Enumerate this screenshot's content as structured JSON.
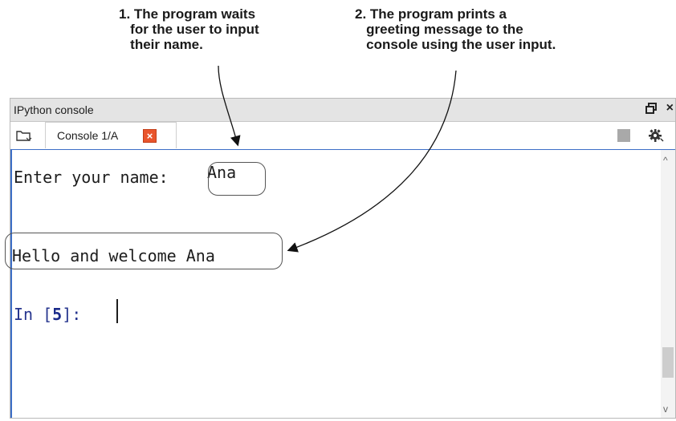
{
  "annotations": {
    "step1": "1. The program waits\n   for the user to input\n   their name.",
    "step2": "2. The program prints a\n   greeting message to the\n   console using the user input."
  },
  "window": {
    "title": "IPython console",
    "undock_icon": "undock-icon",
    "close_icon": "close-icon"
  },
  "tabs": {
    "browse_icon": "browse-tabs-icon",
    "active_tab_label": "Console 1/A",
    "tab_close_icon": "close-icon",
    "stop_icon": "stop-icon",
    "options_icon": "gear-icon"
  },
  "console": {
    "prompt_text": "Enter your name: ",
    "input_value": "Ana",
    "greeting": "Hello and welcome Ana",
    "in_prompt_prefix": "In [",
    "in_prompt_number": "5",
    "in_prompt_suffix": "]: "
  },
  "colors": {
    "accent_border": "#3d6fc7",
    "tab_close_bg": "#e9552c",
    "in_prompt": "#26358e"
  }
}
